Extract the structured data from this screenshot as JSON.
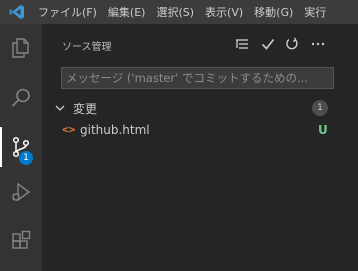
{
  "colors": {
    "menubar_bg": "#3c3c3c",
    "activity_bg": "#333333",
    "sidebar_bg": "#252526",
    "accent": "#007acc",
    "logo": "#3c99d4",
    "untracked": "#73c991",
    "html_icon": "#e37933"
  },
  "menubar": {
    "logo_icon": "vscode-logo-icon",
    "items": [
      {
        "label": "ファイル(F)"
      },
      {
        "label": "編集(E)"
      },
      {
        "label": "選択(S)"
      },
      {
        "label": "表示(V)"
      },
      {
        "label": "移動(G)"
      },
      {
        "label": "実行"
      }
    ]
  },
  "activity_bar": {
    "items": [
      {
        "icon": "explorer-icon"
      },
      {
        "icon": "search-icon"
      },
      {
        "icon": "source-control-icon",
        "active": true,
        "badge": "1"
      },
      {
        "icon": "run-debug-icon"
      },
      {
        "icon": "extensions-icon"
      }
    ]
  },
  "sidebar": {
    "title": "ソース管理",
    "actions": [
      {
        "icon": "view-as-tree-icon"
      },
      {
        "icon": "commit-check-icon"
      },
      {
        "icon": "refresh-icon"
      },
      {
        "icon": "more-actions-icon"
      }
    ],
    "commit_input": {
      "placeholder": "メッセージ ('master' でコミットするための..."
    },
    "changes_group": {
      "label": "変更",
      "count": "1",
      "files": [
        {
          "icon": "html-file-icon",
          "icon_glyph": "<>",
          "name": "github.html",
          "status": "U"
        }
      ]
    }
  }
}
